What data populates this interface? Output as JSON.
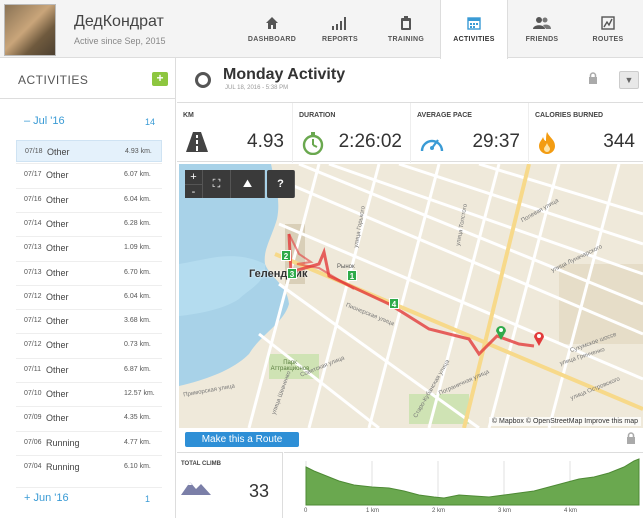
{
  "user": {
    "name": "ДедКондрат",
    "since": "Active since Sep, 2015"
  },
  "nav": [
    {
      "label": "DASHBOARD",
      "icon": "home-icon"
    },
    {
      "label": "REPORTS",
      "icon": "bars-icon"
    },
    {
      "label": "TRAINING",
      "icon": "clipboard-icon"
    },
    {
      "label": "ACTIVITIES",
      "icon": "calendar-icon",
      "active": true
    },
    {
      "label": "FRIENDS",
      "icon": "people-icon"
    },
    {
      "label": "ROUTES",
      "icon": "route-icon"
    }
  ],
  "sidebar": {
    "title": "ACTIVITIES",
    "add": "+",
    "months": [
      {
        "label": "– Jul '16",
        "count": "14"
      },
      {
        "label": "+ Jun '16",
        "count": "1"
      }
    ],
    "activities": [
      {
        "date": "07/18",
        "type": "Other",
        "dist": "4.93 km."
      },
      {
        "date": "07/17",
        "type": "Other",
        "dist": "6.07 km."
      },
      {
        "date": "07/16",
        "type": "Other",
        "dist": "6.04 km."
      },
      {
        "date": "07/14",
        "type": "Other",
        "dist": "6.28 km."
      },
      {
        "date": "07/13",
        "type": "Other",
        "dist": "1.09 km."
      },
      {
        "date": "07/13",
        "type": "Other",
        "dist": "6.70 km."
      },
      {
        "date": "07/12",
        "type": "Other",
        "dist": "6.04 km."
      },
      {
        "date": "07/12",
        "type": "Other",
        "dist": "3.68 km."
      },
      {
        "date": "07/12",
        "type": "Other",
        "dist": "0.73 km."
      },
      {
        "date": "07/11",
        "type": "Other",
        "dist": "6.87 km."
      },
      {
        "date": "07/10",
        "type": "Other",
        "dist": "12.57 km."
      },
      {
        "date": "07/09",
        "type": "Other",
        "dist": "4.35 km."
      },
      {
        "date": "07/06",
        "type": "Running",
        "dist": "4.77 km."
      },
      {
        "date": "07/04",
        "type": "Running",
        "dist": "6.10 km."
      }
    ]
  },
  "activity": {
    "title": "Monday Activity",
    "datetime": "JUL 18, 2016  -  5:38 PM",
    "stats": [
      {
        "label": "KM",
        "value": "4.93",
        "icon": "road-icon"
      },
      {
        "label": "DURATION",
        "value": "2:26:02",
        "icon": "stopwatch-icon"
      },
      {
        "label": "AVERAGE PACE",
        "value": "29:37",
        "icon": "speedometer-icon"
      },
      {
        "label": "CALORIES BURNED",
        "value": "344",
        "icon": "flame-icon"
      }
    ],
    "map": {
      "controls": {
        "zoom_in": "+",
        "zoom_out": "-",
        "fullscreen": "⛶",
        "terrain": "⛰",
        "help": "?"
      },
      "city_label": "Геленджик",
      "streets": [
        "улица Горького",
        "улица Толстого",
        "Пионерская улица",
        "улица Луначарского",
        "Полевая улица",
        "Советская улица",
        "Пограничная улица",
        "улица Островского",
        "улица Гринченко",
        "улица Шевченко",
        "Рынок",
        "Парк Аттракционов",
        "Приморская улица",
        "Сухумское шоссе",
        "Старо-Кубанская улица"
      ],
      "markers": [
        "2",
        "3",
        "1",
        "4"
      ],
      "attribution": "© Mapbox © OpenStreetMap Improve this map"
    },
    "route_button": "Make this a Route",
    "climb": {
      "label": "TOTAL CLIMB",
      "value": "33"
    },
    "profile": {
      "ticks": [
        "0",
        "1 km",
        "2 km",
        "3 km",
        "4 km"
      ]
    }
  },
  "colors": {
    "accent": "#3a9bd5",
    "route": "#e23b3b",
    "elevation": "#6aa84f",
    "add_button": "#8dc63f"
  }
}
